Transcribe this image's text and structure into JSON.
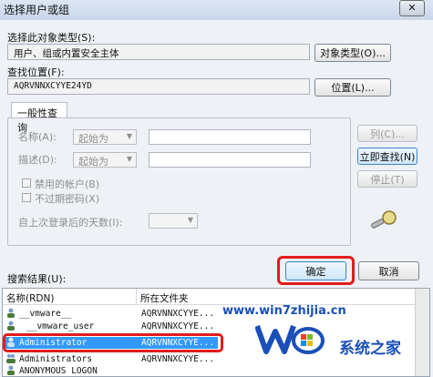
{
  "window": {
    "title": "选择用户或组",
    "close_glyph": "✕"
  },
  "object_type": {
    "label": "选择此对象类型(S):",
    "value": "用户、组或内置安全主体",
    "button": "对象类型(O)..."
  },
  "location": {
    "label": "查找位置(F):",
    "value": "AQRVNNXCYYE24YD",
    "button": "位置(L)..."
  },
  "general_query": {
    "tab_label": "一般性查询",
    "name_label": "名称(A):",
    "name_mode": "起始为",
    "desc_label": "描述(D):",
    "desc_mode": "起始为",
    "disabled_accounts": "禁用的帐户(B)",
    "non_expiring": "不过期密码(X)",
    "days_label": "自上次登录后的天数(I):",
    "columns_button": "列(C)...",
    "find_now_button": "立即查找(N)",
    "stop_button": "停止(T)"
  },
  "results": {
    "label": "搜索结果(U):",
    "col_name": "名称(RDN)",
    "col_folder": "所在文件夹",
    "rows": [
      {
        "name": "__vmware__",
        "folder": "AQRVNNXCYYE..."
      },
      {
        "name": "__vmware_user",
        "folder": "AQRVNNXCYYE..."
      },
      {
        "name": "Administrator",
        "folder": "AQRVNNXCYYE...",
        "selected": true
      },
      {
        "name": "Administrators",
        "folder": "AQRVNNXCYYE..."
      },
      {
        "name": "ANONYMOUS LOGON",
        "folder": ""
      }
    ]
  },
  "ok_button": "确定",
  "cancel_button": "取消",
  "watermark": {
    "site": "www.win7zhijia.cn",
    "brand": "系统之家"
  },
  "colors": {
    "highlight_red": "#e21b1b",
    "selection_blue": "#3399ff",
    "link_blue": "#1a4fb8"
  }
}
